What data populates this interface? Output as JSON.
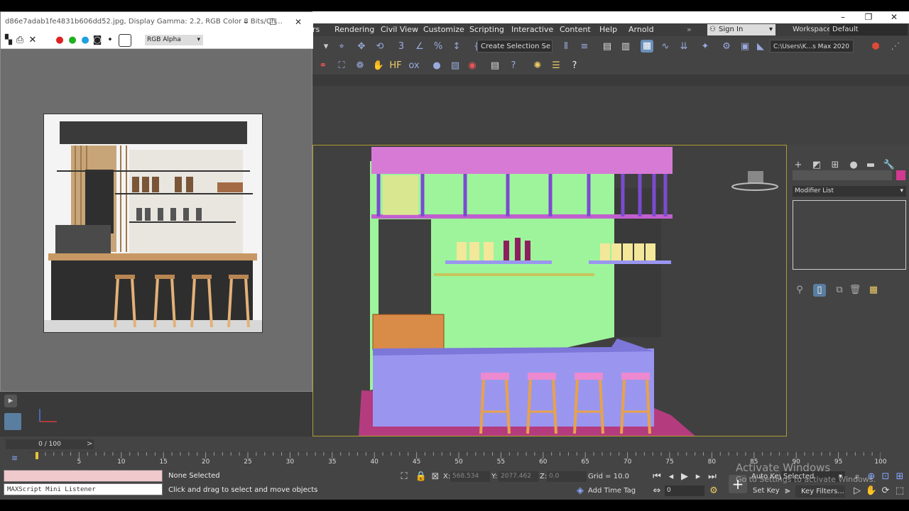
{
  "colors": {
    "accent": "#b09a30",
    "selection": "#d13a90",
    "wall": "#9ef49b",
    "counter": "#9a96f0",
    "stools": "#e9a24a"
  },
  "framebuffer": {
    "title": "d86e7adab1fe4831b606dd52.jpg, Display Gamma: 2.2, RGB Color 8 Bits/Ch...",
    "channel": "RGB Alpha"
  },
  "menu": [
    "rs",
    "Rendering",
    "Civil View",
    "Customize",
    "Scripting",
    "Interactive",
    "Content",
    "Help",
    "Arnold"
  ],
  "signin": "Sign In",
  "workspaces_label": "Workspaces:",
  "workspace": "Default",
  "toolbar": {
    "selection_set": "Create Selection Se",
    "project_path": "C:\\Users\\K...s Max 2020"
  },
  "command_panel": {
    "modifier_list": "Modifier List"
  },
  "timeline": {
    "slider": "0 / 100",
    "ticks": [
      "5",
      "10",
      "15",
      "20",
      "25",
      "30",
      "35",
      "40",
      "45",
      "50",
      "55",
      "60",
      "65",
      "70",
      "75",
      "80",
      "85",
      "90",
      "95",
      "100"
    ]
  },
  "status": {
    "selection": "None Selected",
    "prompt": "Click and drag to select and move objects",
    "listener": "MAXScript Mini Listener",
    "x_label": "X:",
    "x": "568.534",
    "y_label": "Y:",
    "y": "2077.462",
    "z_label": "Z:",
    "z": "0.0",
    "grid": "Grid = 10.0",
    "add_time_tag": "Add Time Tag",
    "auto_key": "Auto Key",
    "selected": "Selected",
    "set_key": "Set Key",
    "key_filters": "Key Filters...",
    "frame": "0"
  },
  "watermark": {
    "line1": "Activate Windows",
    "line2": "Go to Settings to activate Windows."
  }
}
